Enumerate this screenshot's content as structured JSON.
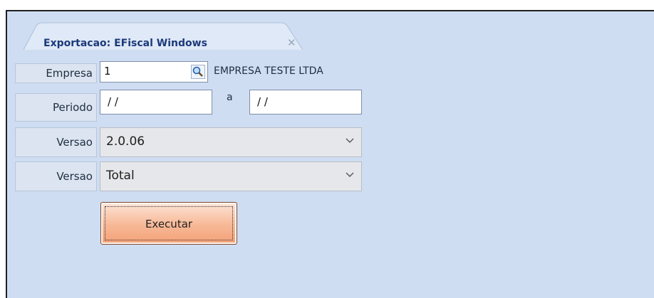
{
  "tab": {
    "title": "Exportacao: EFiscal Windows",
    "close_glyph": "✕"
  },
  "form": {
    "empresa": {
      "label": "Empresa",
      "value": "1",
      "company_name": "EMPRESA TESTE LTDA",
      "lookup_icon": "magnifier-icon"
    },
    "periodo": {
      "label": "Periodo",
      "from": "/ /",
      "separator": "a",
      "to": "/ /"
    },
    "versao1": {
      "label": "Versao",
      "value": "2.0.06"
    },
    "versao2": {
      "label": "Versao",
      "value": "Total"
    },
    "execute_label": "Executar"
  },
  "colors": {
    "panel": "#cfddf2",
    "button": "#f7b896",
    "tab_title": "#1c3a7a"
  }
}
